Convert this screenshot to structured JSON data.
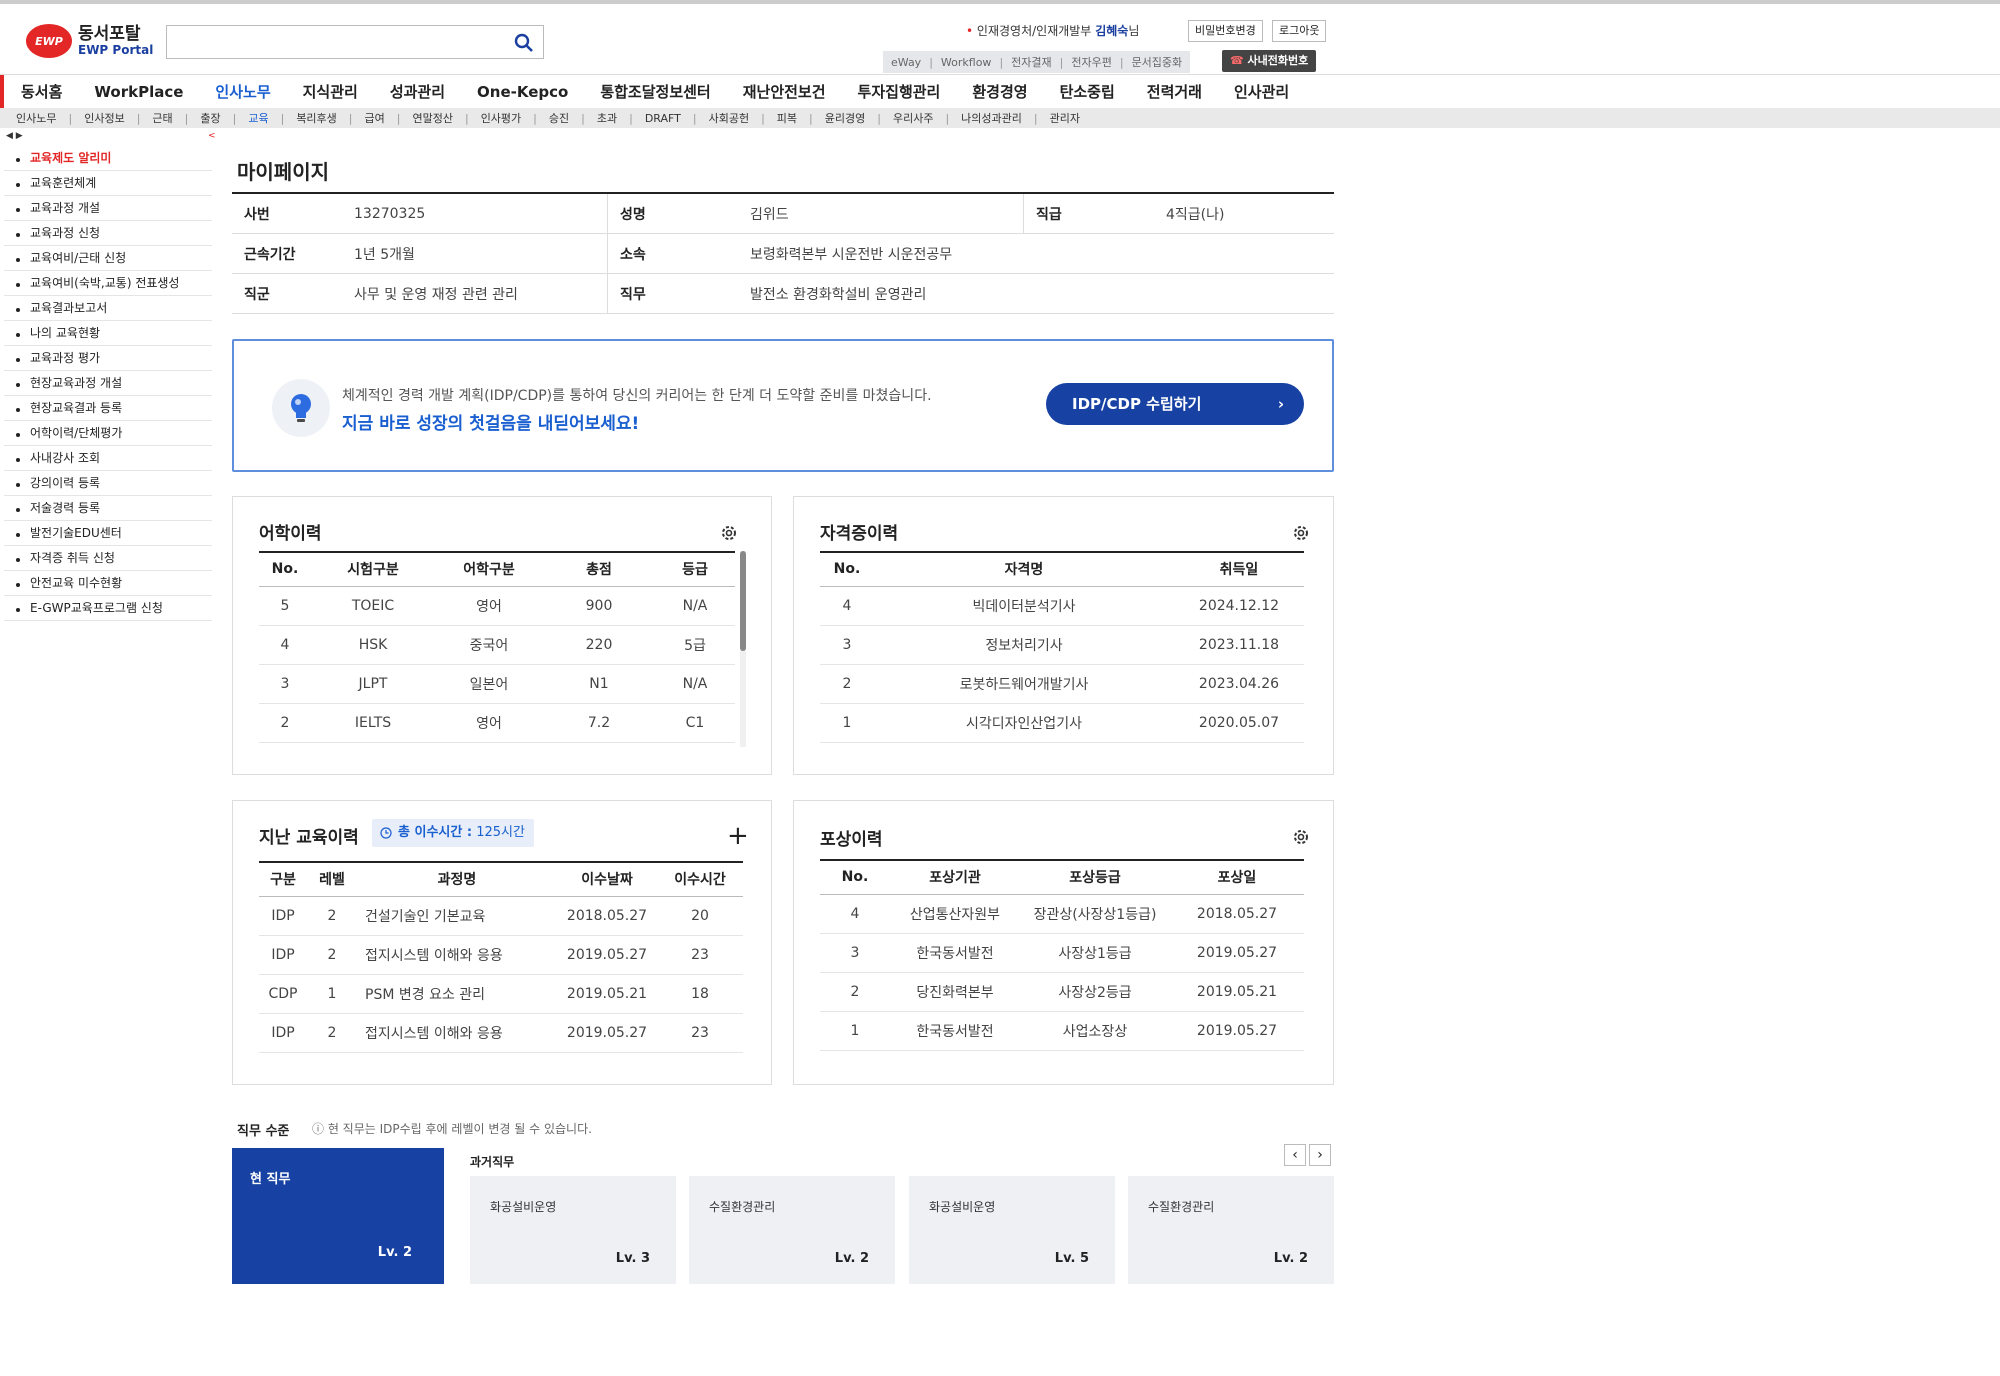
{
  "header": {
    "logo_title": "동서포탈",
    "logo_subtitle": "EWP Portal",
    "logo_mark": "EWP",
    "search_placeholder": "",
    "user_dept": "인재경영처/인재개발부",
    "user_name": "김혜숙",
    "user_suffix": "님",
    "change_password": "비밀번호변경",
    "logout": "로그아웃",
    "quick_links": [
      "eWay",
      "Workflow",
      "전자결재",
      "전자우편",
      "문서집중화"
    ],
    "phone_button": "사내전화번호"
  },
  "mainnav": [
    "동서홈",
    "WorkPlace",
    "인사노무",
    "지식관리",
    "성과관리",
    "One-Kepco",
    "통합조달정보센터",
    "재난안전보건",
    "투자집행관리",
    "환경경영",
    "탄소중립",
    "전력거래",
    "인사관리"
  ],
  "mainnav_active": 2,
  "subnav": [
    "인사노무",
    "인사정보",
    "근태",
    "출장",
    "교육",
    "복리후생",
    "급여",
    "연말정산",
    "인사평가",
    "승진",
    "초과",
    "DRAFT",
    "사회공헌",
    "피복",
    "윤리경영",
    "우리사주",
    "나의성과관리",
    "관리자"
  ],
  "subnav_active": 4,
  "sidebar_toggle": "◀ ▶",
  "sidebar_collapse": "<",
  "sidebar": [
    "교육제도 알리미",
    "교육훈련체계",
    "교육과정 개설",
    "교육과정 신청",
    "교육여비/근태 신청",
    "교육여비(숙박,교통) 전표생성",
    "교육결과보고서",
    "나의 교육현황",
    "교육과정 평가",
    "현장교육과정 개설",
    "현장교육결과 등록",
    "어학이력/단체평가",
    "사내강사 조회",
    "강의이력 등록",
    "저술경력 등록",
    "발전기술EDU센터",
    "자격증 취득 신청",
    "안전교육 미수현황",
    "E-GWP교육프로그램 신청"
  ],
  "page_title": "마이페이지",
  "profile": {
    "emp_no_label": "사번",
    "emp_no": "13270325",
    "name_label": "성명",
    "name": "김위드",
    "grade_label": "직급",
    "grade": "4직급(나)",
    "tenure_label": "근속기간",
    "tenure": "1년 5개월",
    "dept_label": "소속",
    "dept": "보령화력본부 시운전반 시운전공무",
    "jobgroup_label": "직군",
    "jobgroup": "사무 및 운영 재정 관련 관리",
    "duty_label": "직무",
    "duty": "발전소 환경화학설비 운영관리"
  },
  "banner": {
    "text1": "체계적인 경력 개발 계획(IDP/CDP)를 통하여 당신의 커리어는 한 단계 더 도약할 준비를 마쳤습니다.",
    "text2": "지금 바로 성장의 첫걸음을 내딛어보세요!",
    "button": "IDP/CDP 수립하기",
    "button_arrow": "›"
  },
  "language": {
    "title": "어학이력",
    "headers": [
      "No.",
      "시험구분",
      "어학구분",
      "총점",
      "등급"
    ],
    "rows": [
      [
        "5",
        "TOEIC",
        "영어",
        "900",
        "N/A"
      ],
      [
        "4",
        "HSK",
        "중국어",
        "220",
        "5급"
      ],
      [
        "3",
        "JLPT",
        "일본어",
        "N1",
        "N/A"
      ],
      [
        "2",
        "IELTS",
        "영어",
        "7.2",
        "C1"
      ]
    ]
  },
  "certs": {
    "title": "자격증이력",
    "headers": [
      "No.",
      "자격명",
      "취득일"
    ],
    "rows": [
      [
        "4",
        "빅데이터분석기사",
        "2024.12.12"
      ],
      [
        "3",
        "정보처리기사",
        "2023.11.18"
      ],
      [
        "2",
        "로봇하드웨어개발기사",
        "2023.04.26"
      ],
      [
        "1",
        "시각디자인산업기사",
        "2020.05.07"
      ]
    ]
  },
  "training": {
    "title": "지난 교육이력",
    "badge_label": "총 이수시간 :",
    "badge_value": "125시간",
    "plus": "+",
    "headers": [
      "구분",
      "레벨",
      "과정명",
      "이수날짜",
      "이수시간"
    ],
    "rows": [
      [
        "IDP",
        "2",
        "건설기술인 기본교육",
        "2018.05.27",
        "20"
      ],
      [
        "IDP",
        "2",
        "접지시스템 이해와 응용",
        "2019.05.27",
        "23"
      ],
      [
        "CDP",
        "1",
        "PSM 변경 요소 관리",
        "2019.05.21",
        "18"
      ],
      [
        "IDP",
        "2",
        "접지시스템 이해와 응용",
        "2019.05.27",
        "23"
      ]
    ]
  },
  "awards": {
    "title": "포상이력",
    "headers": [
      "No.",
      "포상기관",
      "포상등급",
      "포상일"
    ],
    "rows": [
      [
        "4",
        "산업통산자원부",
        "장관상(사장상1등급)",
        "2018.05.27"
      ],
      [
        "3",
        "한국동서발전",
        "사장상1등급",
        "2019.05.27"
      ],
      [
        "2",
        "당진화력본부",
        "사장상2등급",
        "2019.05.21"
      ],
      [
        "1",
        "한국동서발전",
        "사업소장상",
        "2019.05.27"
      ]
    ]
  },
  "levels": {
    "title": "직무 수준",
    "note": "ⓘ 현 직무는 IDP수립 후에 레벨이 변경 될 수 있습니다.",
    "current_label": "현 직무",
    "current_level": "Lv. 2",
    "past_title": "과거직무",
    "prev_arrow": "‹",
    "next_arrow": "›",
    "past": [
      [
        "화공설비운영",
        "Lv. 3"
      ],
      [
        "수질환경관리",
        "Lv. 2"
      ],
      [
        "화공설비운영",
        "Lv. 5"
      ],
      [
        "수질환경관리",
        "Lv. 2"
      ]
    ]
  },
  "colors": {
    "accent": "#1742a3",
    "brand_red": "#e32626",
    "link_blue": "#1a5fd0"
  }
}
